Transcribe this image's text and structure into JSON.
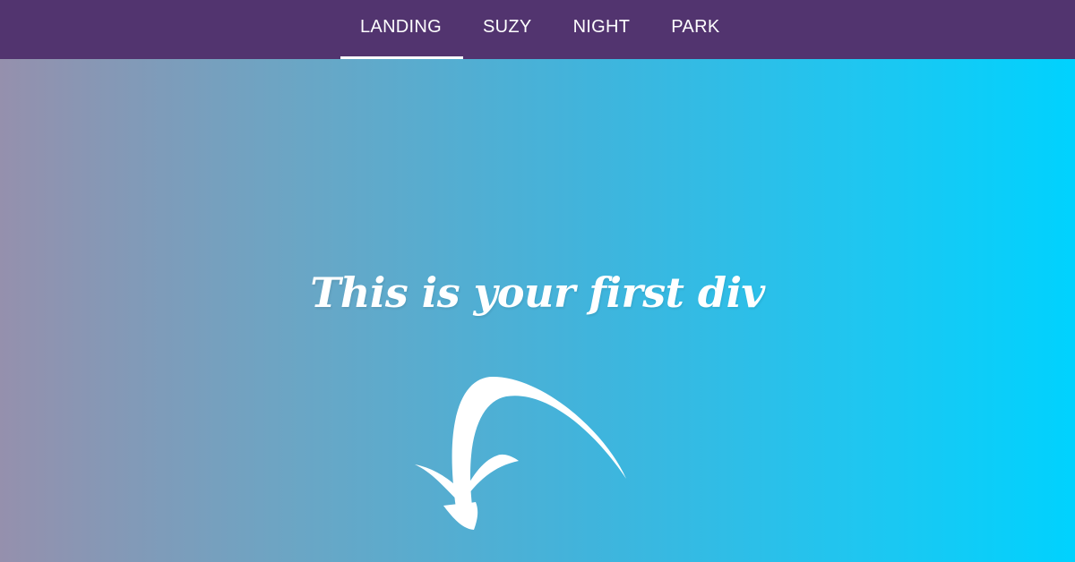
{
  "nav": {
    "items": [
      {
        "label": "LANDING",
        "active": true
      },
      {
        "label": "SUZY",
        "active": false
      },
      {
        "label": "NIGHT",
        "active": false
      },
      {
        "label": "PARK",
        "active": false
      }
    ],
    "background_color": "#52346f"
  },
  "hero": {
    "title": "This is your first div",
    "arrow_icon": "curved-arrow-down-left-icon",
    "gradient_colors": [
      "#9590ad",
      "#6aa6c5",
      "#40b4dc",
      "#1fc6f0",
      "#00d2fe"
    ]
  }
}
